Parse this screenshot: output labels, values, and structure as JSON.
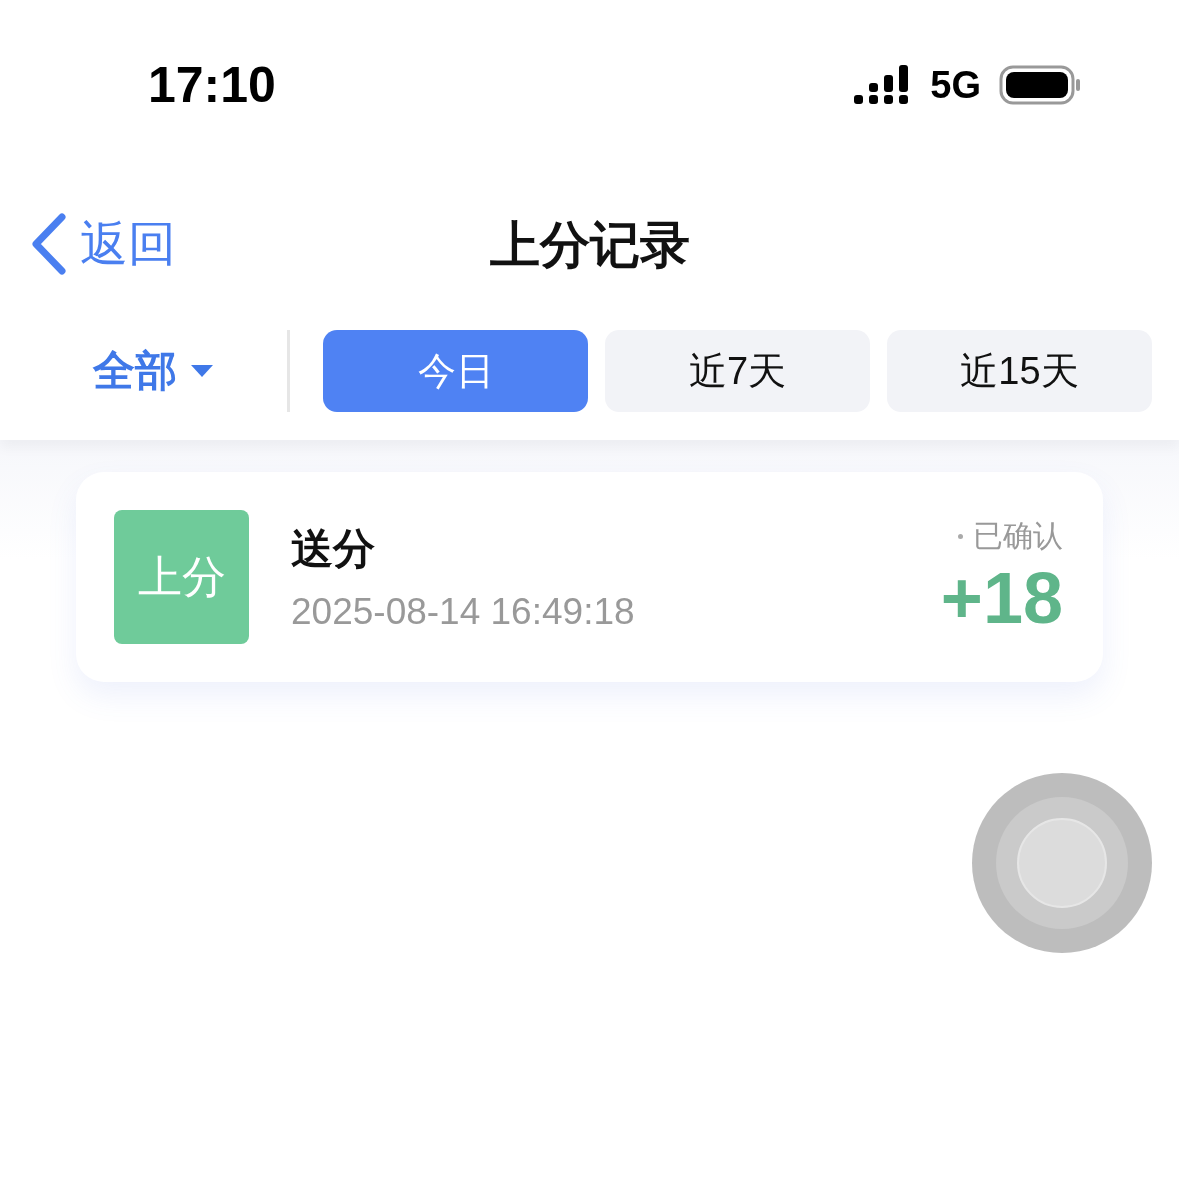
{
  "status_bar": {
    "time": "17:10",
    "network": "5G"
  },
  "nav": {
    "back": "返回",
    "title": "上分记录"
  },
  "filter": {
    "dropdown": "全部",
    "tabs": [
      {
        "label": "今日",
        "selected": true
      },
      {
        "label": "近7天",
        "selected": false
      },
      {
        "label": "近15天",
        "selected": false
      }
    ]
  },
  "records": [
    {
      "tag": "上分",
      "title": "送分",
      "time": "2025-08-14 16:49:18",
      "status": "已确认",
      "amount": "+18"
    }
  ]
}
